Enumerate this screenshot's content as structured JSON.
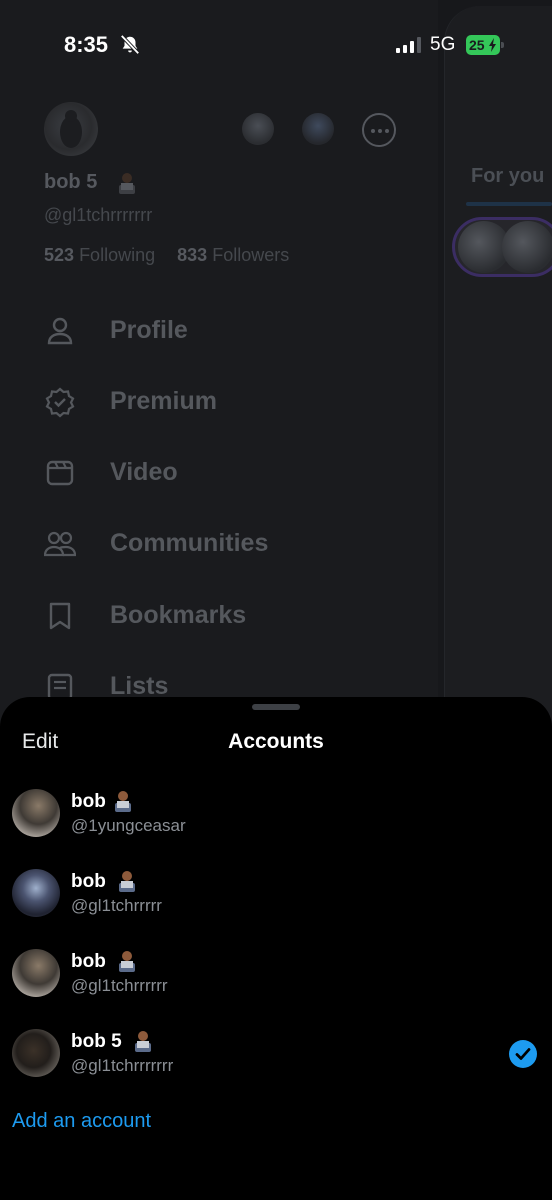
{
  "status_bar": {
    "time": "8:35",
    "network": "5G",
    "battery": "25",
    "icons": [
      "bell-off-icon",
      "signal-icon",
      "battery-charging-icon"
    ]
  },
  "drawer": {
    "name": "bob 5",
    "handle": "@gl1tchrrrrrrr",
    "following_count": "523",
    "following_label": "Following",
    "followers_count": "833",
    "followers_label": "Followers",
    "nav": [
      {
        "label": "Profile",
        "icon": "person-icon"
      },
      {
        "label": "Premium",
        "icon": "verified-badge-icon"
      },
      {
        "label": "Video",
        "icon": "video-icon"
      },
      {
        "label": "Communities",
        "icon": "communities-icon"
      },
      {
        "label": "Bookmarks",
        "icon": "bookmark-icon"
      },
      {
        "label": "Lists",
        "icon": "list-icon"
      }
    ]
  },
  "feed": {
    "tab_label": "For you"
  },
  "sheet": {
    "title": "Accounts",
    "edit_label": "Edit",
    "add_account_label": "Add an account",
    "accounts": [
      {
        "name": "bob",
        "handle": "@1yungceasar",
        "selected": false
      },
      {
        "name": "bob",
        "handle": "@gl1tchrrrrr",
        "selected": false
      },
      {
        "name": "bob",
        "handle": "@gl1tchrrrrrr",
        "selected": false
      },
      {
        "name": "bob 5",
        "handle": "@gl1tchrrrrrrr",
        "selected": true
      }
    ]
  },
  "colors": {
    "accent": "#1d9bf0",
    "battery": "#34c759",
    "sheet_bg": "#000000",
    "dim_bg": "#1a1b1e"
  }
}
